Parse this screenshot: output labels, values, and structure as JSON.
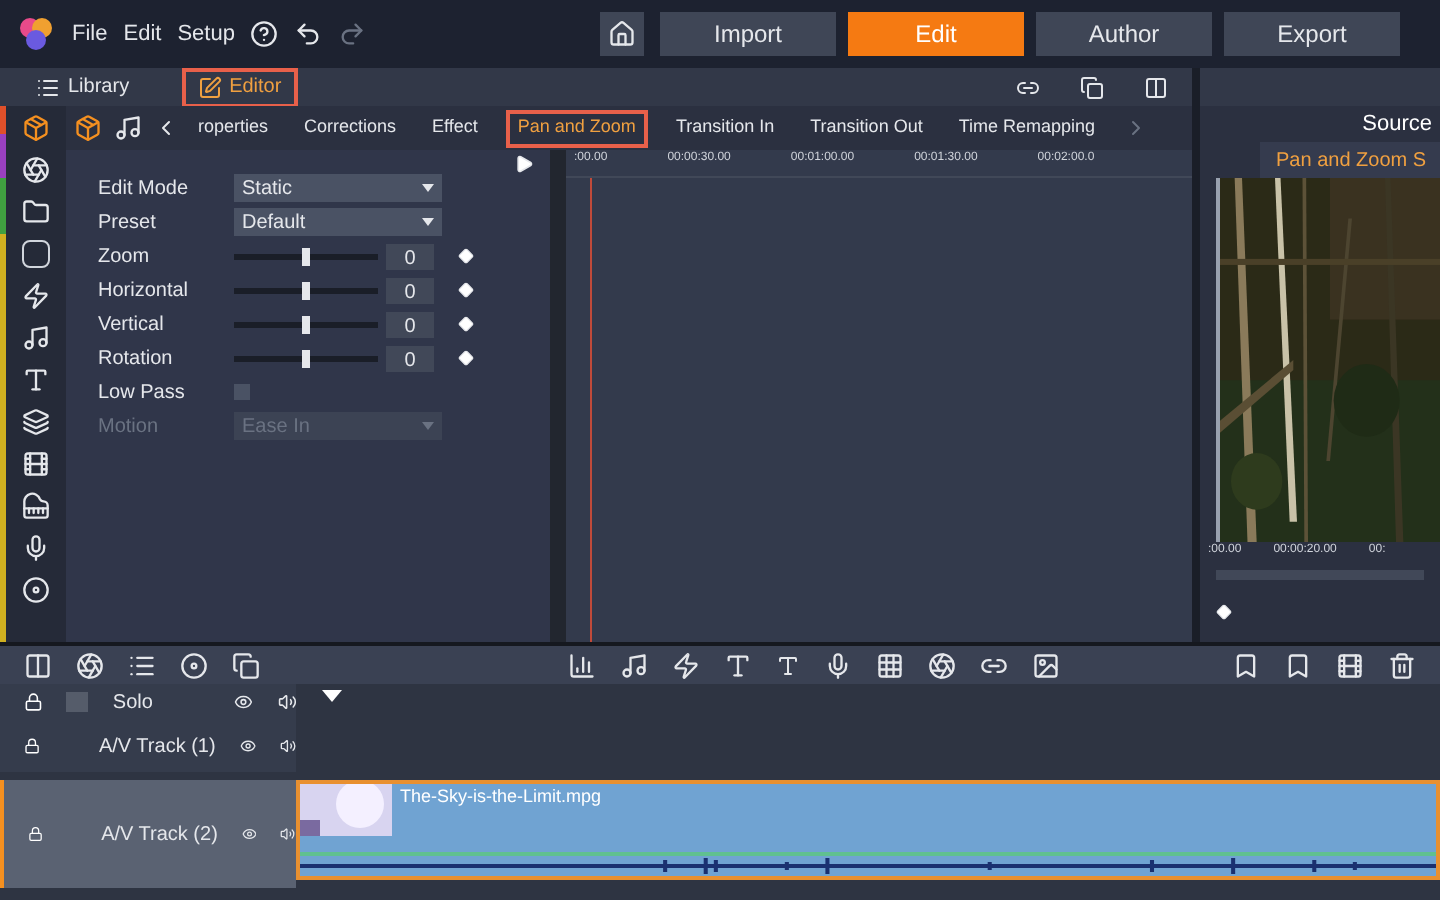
{
  "menu": [
    "File",
    "Edit",
    "Setup"
  ],
  "nav": [
    {
      "label": "Import",
      "selected": false
    },
    {
      "label": "Edit",
      "selected": true
    },
    {
      "label": "Author",
      "selected": false
    },
    {
      "label": "Export",
      "selected": false
    }
  ],
  "panel_tabs": [
    {
      "label": "Library",
      "selected": false
    },
    {
      "label": "Editor",
      "selected": true
    }
  ],
  "editor_tabs": [
    {
      "label": "roperties",
      "selected": false
    },
    {
      "label": "Corrections",
      "selected": false
    },
    {
      "label": "Effect",
      "selected": false
    },
    {
      "label": "Pan and Zoom",
      "selected": true
    },
    {
      "label": "Transition In",
      "selected": false
    },
    {
      "label": "Transition Out",
      "selected": false
    },
    {
      "label": "Time Remapping",
      "selected": false
    }
  ],
  "form": [
    {
      "kind": "select",
      "label": "Edit Mode",
      "value": "Static",
      "disabled": false
    },
    {
      "kind": "select",
      "label": "Preset",
      "value": "Default",
      "disabled": false
    },
    {
      "kind": "slider",
      "label": "Zoom",
      "level": 0.5,
      "value": "0"
    },
    {
      "kind": "slider",
      "label": "Horizontal",
      "level": 0.5,
      "value": "0"
    },
    {
      "kind": "slider",
      "label": "Vertical",
      "level": 0.5,
      "value": "0"
    },
    {
      "kind": "slider",
      "label": "Rotation",
      "level": 0.5,
      "value": "0"
    },
    {
      "kind": "checkbox",
      "label": "Low Pass",
      "checked": false
    },
    {
      "kind": "select",
      "label": "Motion",
      "value": "Ease In",
      "disabled": true
    }
  ],
  "ruler": [
    ":00.00",
    "00:00:30.00",
    "00:01:00.00",
    "00:01:30.00",
    "00:02:00.0"
  ],
  "preview": {
    "tab": "Source",
    "title": "Pan and Zoom S",
    "ruler": [
      ":00.00",
      "00:00:20.00",
      "00:"
    ]
  },
  "tracks": [
    {
      "kind": "solo",
      "name": "Solo",
      "selected": false
    },
    {
      "kind": "track",
      "name": "A/V Track (1)",
      "selected": false
    },
    {
      "kind": "track",
      "name": "A/V Track (2)",
      "selected": true,
      "clip": "The-Sky-is-the-Limit.mpg"
    }
  ]
}
